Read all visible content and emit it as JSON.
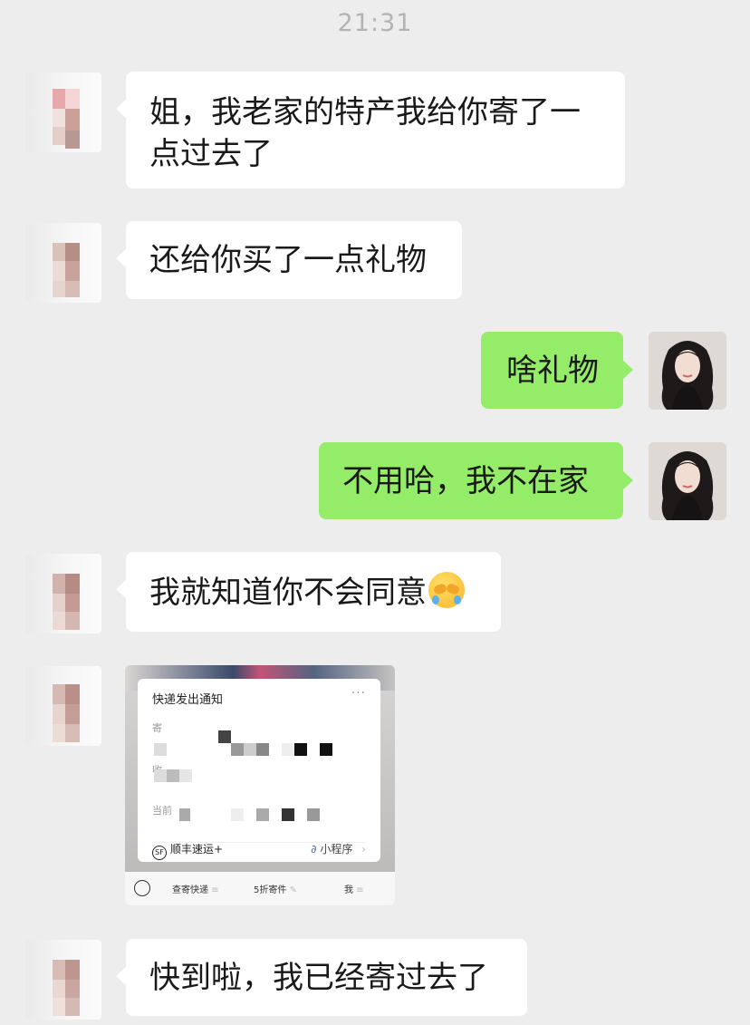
{
  "header": {
    "time": "21:31"
  },
  "messages": [
    {
      "side": "left",
      "text_line1": "姐，我老家的特产我给你寄了一",
      "text_line2": "点过去了"
    },
    {
      "side": "left",
      "text": "还给你买了一点礼物"
    },
    {
      "side": "right",
      "text": "啥礼物"
    },
    {
      "side": "right",
      "text": "不用哈，我不在家"
    },
    {
      "side": "left",
      "text": "我就知道你不会同意",
      "emoji": "face-with-hands-crying-icon"
    },
    {
      "side": "left",
      "type": "image"
    },
    {
      "side": "left",
      "text": "快到啦，我已经寄过去了"
    }
  ],
  "card": {
    "title": "快递发出通知",
    "more": "···",
    "label_send": "寄",
    "label_receive": "收",
    "label_status": "当前",
    "carrier": "顺丰速运+",
    "carrier_logo": "SF",
    "mini_program": "小程序",
    "chevron": "›"
  },
  "tabbar": {
    "tab1": "查寄快递",
    "tab1_menu": "≡",
    "tab2": "5折寄件",
    "tab2_icon": "✎",
    "tab3": "我",
    "tab3_menu": "≡"
  },
  "colors": {
    "bg": "#ededed",
    "incoming": "#ffffff",
    "outgoing": "#95ec69"
  }
}
